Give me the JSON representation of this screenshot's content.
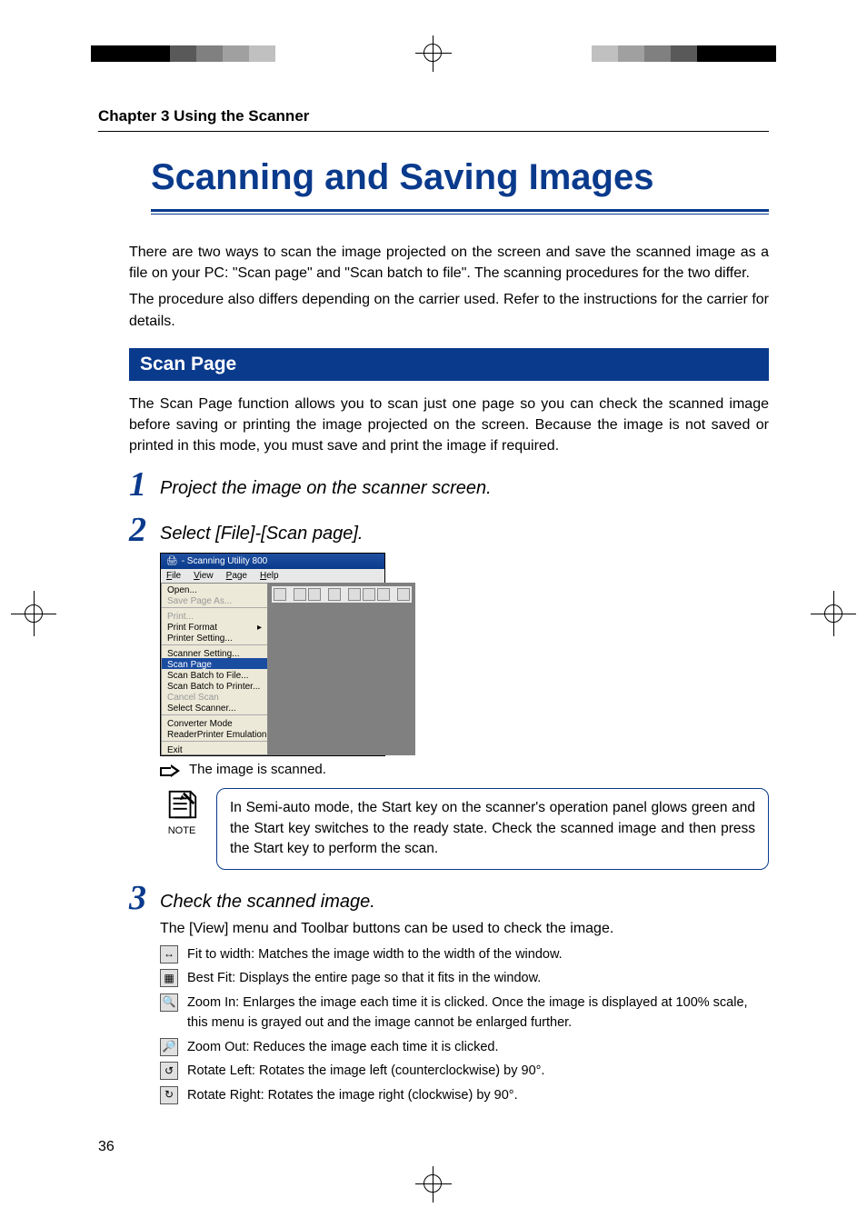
{
  "chapter": "Chapter 3 Using the Scanner",
  "title": "Scanning and Saving Images",
  "intro1": "There are two ways to scan the image projected on the screen and save the scanned image as a file on your PC: \"Scan page\" and \"Scan batch to file\". The scanning procedures for the two differ.",
  "intro2": "The procedure also differs depending on the carrier used. Refer to the instructions for the carrier for details.",
  "section_bar": "Scan Page",
  "section_desc": "The Scan Page function allows you to scan just one page so you can check the scanned image before saving or printing the image projected on the screen. Because the image is not saved or printed in this mode, you must save and print the image if required.",
  "steps": {
    "s1": "Project the image on the scanner screen.",
    "s2": "Select [File]-[Scan page].",
    "s3": "Check the scanned image."
  },
  "screenshot": {
    "title": " - Scanning Utility 800",
    "menu": [
      "File",
      "View",
      "Page",
      "Help"
    ],
    "items": {
      "open": "Open...",
      "save": "Save Page As...",
      "print": "Print...",
      "printfmt": "Print Format",
      "printset": "Printer Setting...",
      "scanset": "Scanner Setting...",
      "scanpage": "Scan Page",
      "scanbatchfile": "Scan Batch to File...",
      "scanbatchprint": "Scan Batch to Printer...",
      "cancel": "Cancel Scan",
      "selscan": "Select Scanner...",
      "convmode": "Converter Mode",
      "rpemu": "ReaderPrinter Emulation Mode",
      "exit": "Exit"
    }
  },
  "scan_result": "The image is scanned.",
  "note_label": "NOTE",
  "note_text": "In Semi-auto mode, the Start key on the scanner's operation panel glows green and the Start key switches to the ready state. Check the scanned image and then press the Start key to perform the scan.",
  "step3_sub": "The [View] menu and Toolbar buttons can be used to check the image.",
  "tools": {
    "fit_width": "Fit to width: Matches the image width to the width of the window.",
    "best_fit": "Best Fit: Displays the entire page so that it fits in the window.",
    "zoom_in": "Zoom In: Enlarges the image each time it is clicked. Once the image is displayed at 100% scale, this menu is grayed out and the image cannot be enlarged further.",
    "zoom_out": "Zoom Out: Reduces the image each time it is clicked.",
    "rot_left": "Rotate Left: Rotates the image left (counterclockwise) by 90°.",
    "rot_right": "Rotate Right: Rotates the image right (clockwise) by 90°."
  },
  "page_num": "36"
}
